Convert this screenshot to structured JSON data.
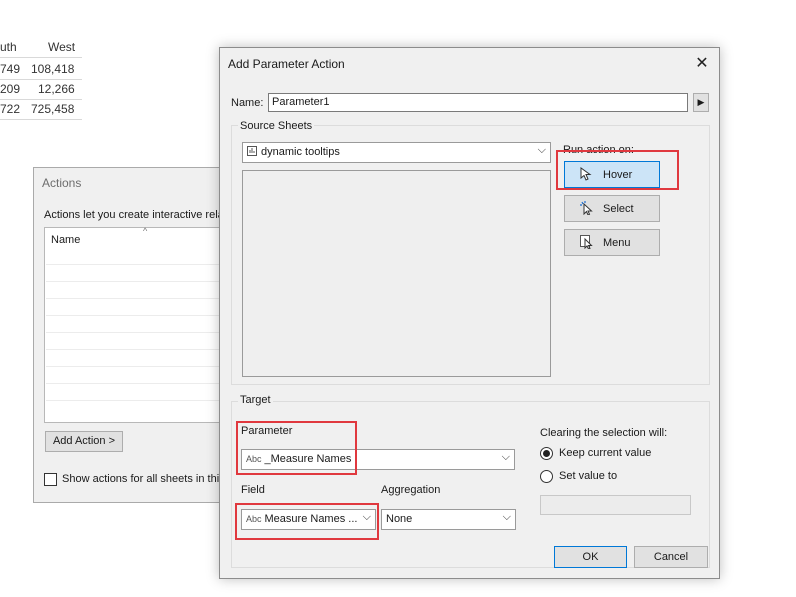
{
  "background_table": {
    "headers": [
      "uth",
      "West"
    ],
    "rows": [
      [
        "749",
        "108,418"
      ],
      [
        "209",
        "12,266"
      ],
      [
        "722",
        "725,458"
      ]
    ]
  },
  "actions_window": {
    "title": "Actions",
    "description": "Actions let you create interactive rela",
    "list_header": "Name",
    "add_action_label": "Add Action >",
    "show_all_label": "Show actions for all sheets in this"
  },
  "dialog": {
    "title": "Add Parameter Action",
    "name_label": "Name:",
    "name_value": "Parameter1",
    "source_sheets_label": "Source Sheets",
    "source_sheet_value": "dynamic tooltips",
    "run_action_on_label": "Run action on:",
    "run_buttons": [
      {
        "label": "Hover",
        "icon": "cursor-icon",
        "selected": true
      },
      {
        "label": "Select",
        "icon": "select-cursor-icon",
        "selected": false
      },
      {
        "label": "Menu",
        "icon": "menu-cursor-icon",
        "selected": false
      }
    ],
    "target_label": "Target",
    "parameter_label": "Parameter",
    "parameter_type": "Abc",
    "parameter_value": "_Measure Names",
    "field_label": "Field",
    "field_type": "Abc",
    "field_value": "Measure Names ...",
    "aggregation_label": "Aggregation",
    "aggregation_value": "None",
    "clearing_label": "Clearing the selection will:",
    "clearing_options": [
      {
        "label": "Keep current value",
        "selected": true
      },
      {
        "label": "Set value to",
        "selected": false
      }
    ],
    "set_value_input": "",
    "ok_label": "OK",
    "cancel_label": "Cancel"
  },
  "colors": {
    "highlight": "#e0383e",
    "selected_button": "#cce4f7",
    "accent": "#0078d7"
  }
}
